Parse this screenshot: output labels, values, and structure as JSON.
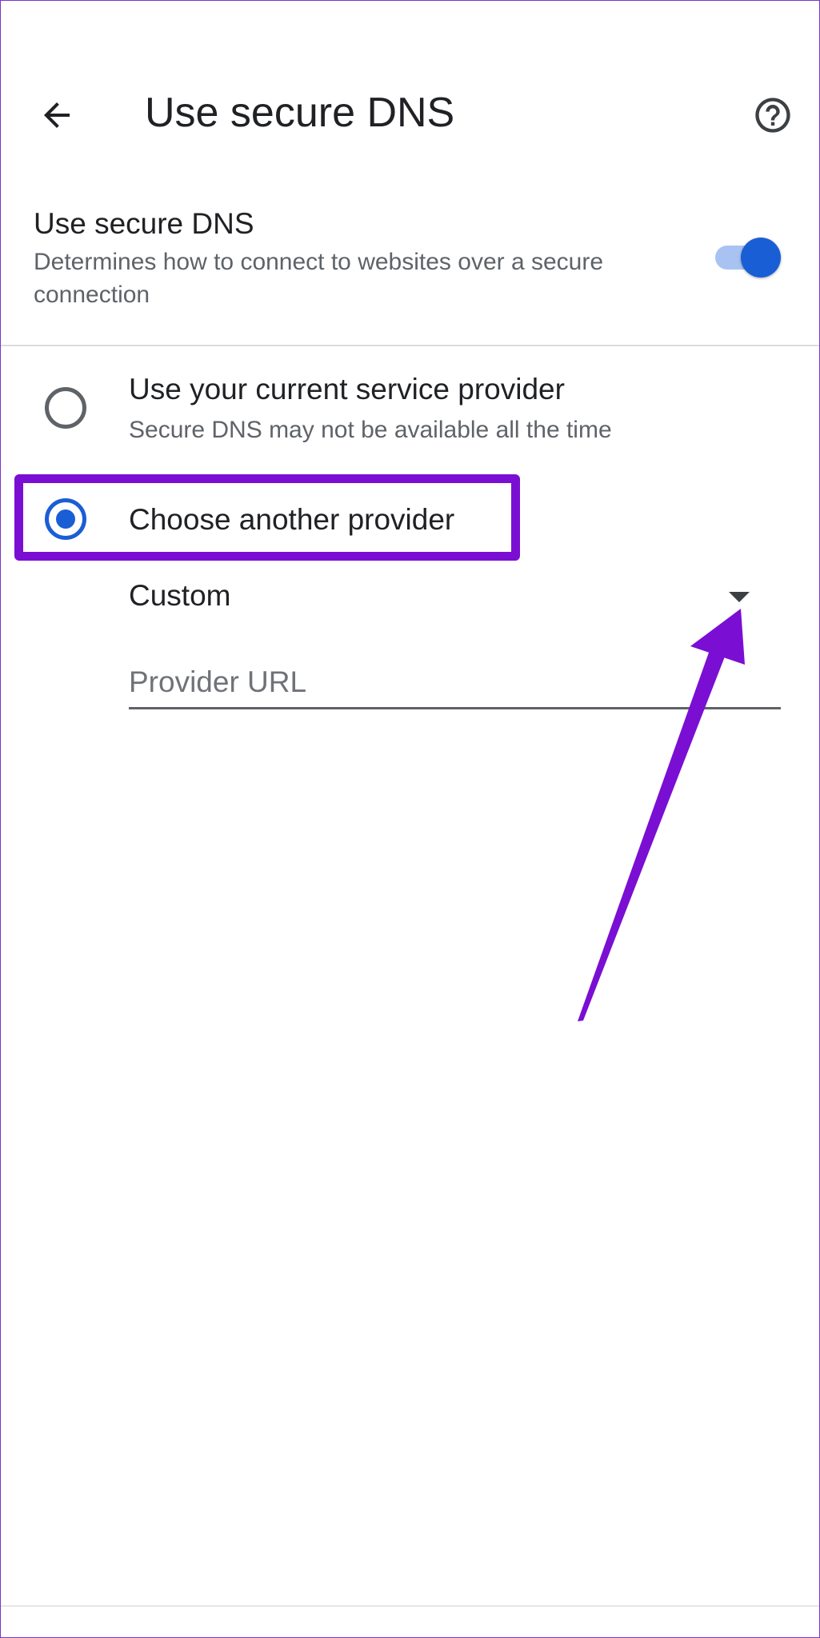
{
  "app_bar": {
    "title": "Use secure DNS",
    "back_icon": "arrow-back-icon",
    "help_icon": "help-circle-icon"
  },
  "secure_dns": {
    "title": "Use secure DNS",
    "description": "Determines how to connect to websites over a secure connection",
    "enabled": true
  },
  "options": {
    "current_provider": {
      "title": "Use your current service provider",
      "subtitle": "Secure DNS may not be available all the time",
      "selected": false
    },
    "another_provider": {
      "title": "Choose another provider",
      "selected": true
    }
  },
  "provider_select": {
    "value": "Custom",
    "arrow_icon": "dropdown-arrow-icon"
  },
  "provider_url": {
    "value": "",
    "placeholder": "Provider URL"
  },
  "colors": {
    "accent": "#1a5ed6",
    "toggle_track": "#a8c3f2",
    "annotation": "#7a0fd3"
  }
}
